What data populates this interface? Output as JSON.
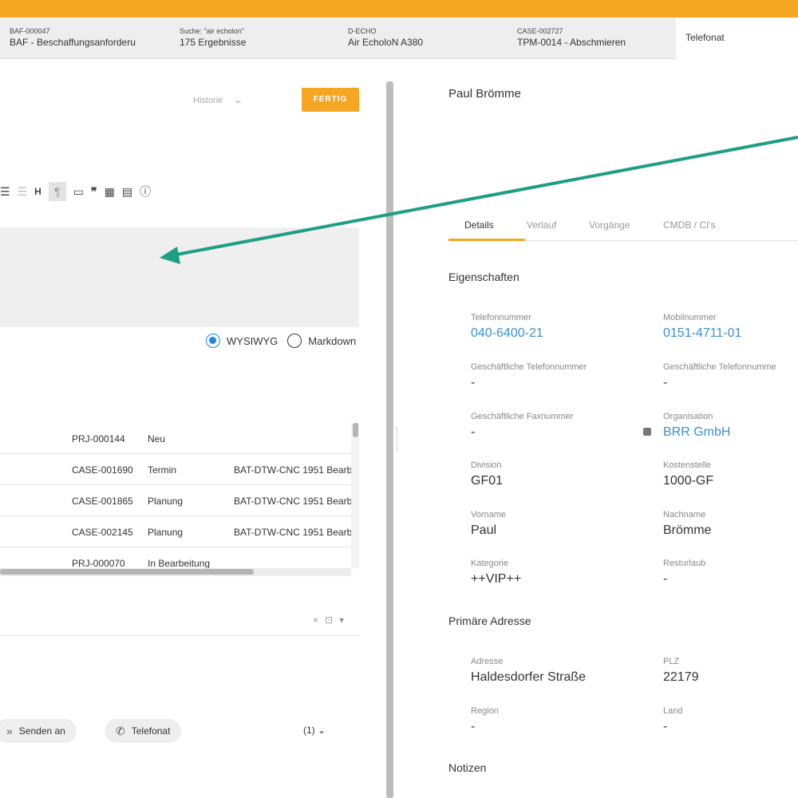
{
  "tabs": [
    {
      "line1": "BAF-000047",
      "line2": "BAF - Beschaffungsanforderu"
    },
    {
      "line1": "Suche: \"air echolon\"",
      "line2": "175 Ergebnisse"
    },
    {
      "line1": "D-ECHO",
      "line2": "Air EcholoN A380"
    },
    {
      "line1": "CASE-002727",
      "line2": "TPM-0014 - Abschmieren"
    },
    {
      "line1": "",
      "line2": "Telefonat"
    }
  ],
  "left": {
    "historie_label": "Historie",
    "fertig_label": "FERTIG",
    "toolbar_icons": [
      "list-icon",
      "outdent-icon",
      "heading-icon",
      "paragraph-icon",
      "code-icon",
      "quote-icon",
      "table-icon",
      "document-icon",
      "info-icon"
    ],
    "mode_wysiwyg": "WYSIWYG",
    "mode_markdown": "Markdown",
    "mode_selected": "WYSIWYG",
    "rows": [
      {
        "id": "PRJ-000144",
        "status": "Neu",
        "title": ""
      },
      {
        "id": "CASE-001690",
        "status": "Termin",
        "title": "BAT-DTW-CNC 1951 Bearb"
      },
      {
        "id": "CASE-001865",
        "status": "Planung",
        "title": "BAT-DTW-CNC 1951 Bearb"
      },
      {
        "id": "CASE-002145",
        "status": "Planung",
        "title": "BAT-DTW-CNC 1951 Bearb"
      },
      {
        "id": "PRJ-000070",
        "status": "In Bearbeitung",
        "title": ""
      }
    ],
    "senden_label": "Senden an",
    "telefonat_label": "Telefonat",
    "count_label": "(1)"
  },
  "right": {
    "title": "Paul Brömme",
    "tabs": [
      "Details",
      "Verlauf",
      "Vorgänge",
      "CMDB / CI's"
    ],
    "active_tab": "Details",
    "section_eigenschaften": "Eigenschaften",
    "section_adresse": "Primäre Adresse",
    "section_notizen": "Notizen",
    "fields": {
      "telefon": {
        "label": "Telefonnummer",
        "value": "040-6400-21"
      },
      "mobil": {
        "label": "Mobilnummer",
        "value": "0151-4711-01"
      },
      "gesch_tel": {
        "label": "Geschäftliche Telefonnummer",
        "value": "-"
      },
      "gesch_tel2": {
        "label": "Geschäftliche Telefonnumme",
        "value": "-"
      },
      "fax": {
        "label": "Geschäftliche Faxnummer",
        "value": "-"
      },
      "org": {
        "label": "Organisation",
        "value": "BRR GmbH"
      },
      "division": {
        "label": "Division",
        "value": "GF01"
      },
      "kostenstelle": {
        "label": "Kostenstelle",
        "value": "1000-GF"
      },
      "vorname": {
        "label": "Vorname",
        "value": "Paul"
      },
      "nachname": {
        "label": "Nachname",
        "value": "Brömme"
      },
      "kategorie": {
        "label": "Kategorie",
        "value": "++VIP++"
      },
      "resturlaub": {
        "label": "Resturlaub",
        "value": "-"
      },
      "adresse": {
        "label": "Adresse",
        "value": "Haldesdorfer Straße"
      },
      "plz": {
        "label": "PLZ",
        "value": "22179"
      },
      "region": {
        "label": "Region",
        "value": "-"
      },
      "land": {
        "label": "Land",
        "value": "-"
      }
    }
  },
  "colors": {
    "accent": "#f5a623",
    "link": "#3a8fd6",
    "arrow": "#1e9e82",
    "radio": "#1e88e5"
  }
}
